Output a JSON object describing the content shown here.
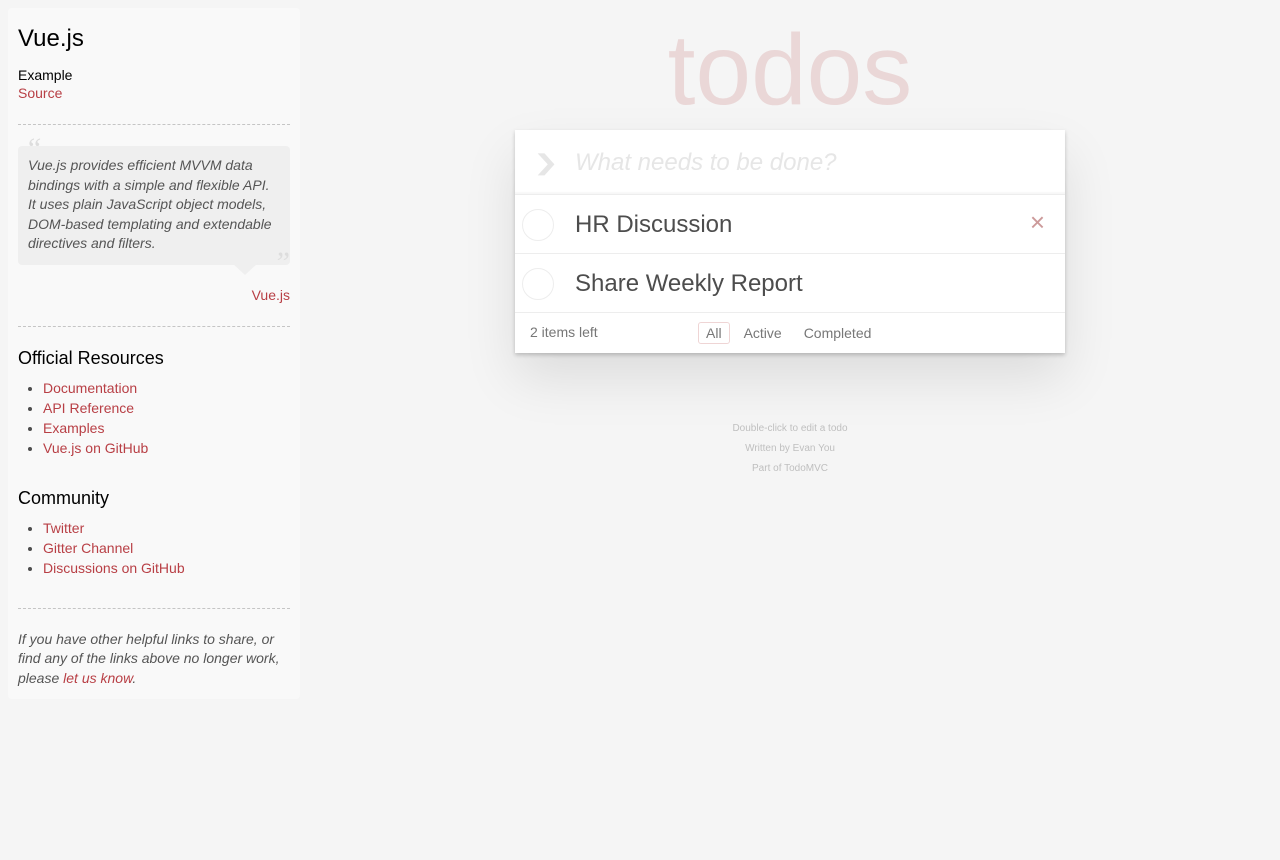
{
  "sidebar": {
    "title": "Vue.js",
    "example_label": "Example",
    "source_link": "Source",
    "quote": "Vue.js provides efficient MVVM data bindings with a simple and flexible API. It uses plain JavaScript object models, DOM-based templating and extendable directives and filters.",
    "quote_author": "Vue.js",
    "resources_heading": "Official Resources",
    "resources": [
      "Documentation",
      "API Reference",
      "Examples",
      "Vue.js on GitHub"
    ],
    "community_heading": "Community",
    "community": [
      "Twitter",
      "Gitter Channel",
      "Discussions on GitHub"
    ],
    "footer_text_before": "If you have other helpful links to share, or find any of the links above no longer work, please ",
    "footer_link": "let us know",
    "footer_text_after": "."
  },
  "app": {
    "title": "todos",
    "toggle_all_icon": "chevron-down-icon",
    "new_todo_placeholder": "What needs to be done?",
    "todos": [
      {
        "label": "HR Discussion",
        "completed": false
      },
      {
        "label": "Share Weekly Report",
        "completed": false
      }
    ],
    "items_left": "2 items left",
    "filters": [
      "All",
      "Active",
      "Completed"
    ],
    "selected_filter": "All",
    "destroy_icon": "×"
  },
  "info": {
    "line1": "Double-click to edit a todo",
    "line2_prefix": "Written by ",
    "line2_link": "Evan You",
    "line3_prefix": "Part of ",
    "line3_link": "TodoMVC"
  }
}
